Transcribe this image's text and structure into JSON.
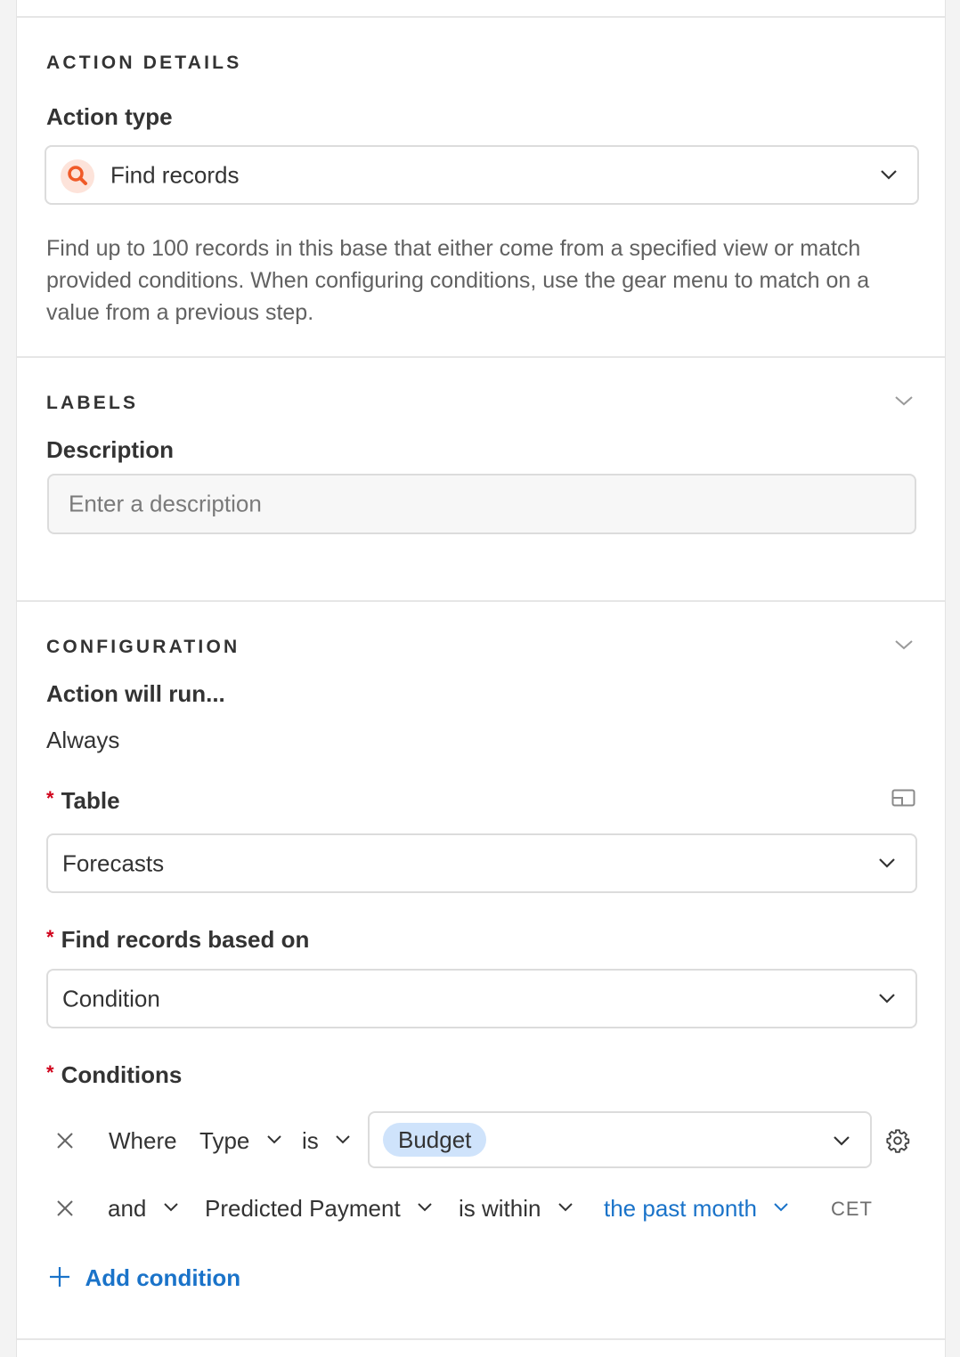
{
  "action_details": {
    "section_title": "ACTION DETAILS",
    "action_type_label": "Action type",
    "action_type_value": "Find records",
    "description": "Find up to 100 records in this base that either come from a specified view or match provided conditions. When configuring conditions, use the gear menu to match on a value from a previous step."
  },
  "labels": {
    "section_title": "LABELS",
    "description_label": "Description",
    "description_placeholder": "Enter a description"
  },
  "configuration": {
    "section_title": "CONFIGURATION",
    "run_label": "Action will run...",
    "run_value": "Always",
    "required_mark": "*",
    "table_label": "Table",
    "table_value": "Forecasts",
    "based_on_label": "Find records based on",
    "based_on_value": "Condition",
    "conditions_label": "Conditions",
    "conditions": [
      {
        "conjunction": "Where",
        "field": "Type",
        "operator": "is",
        "value": "Budget"
      },
      {
        "conjunction": "and",
        "field": "Predicted Payment",
        "operator": "is within",
        "value": "the past month",
        "timezone": "CET"
      }
    ],
    "add_condition_label": "Add condition"
  },
  "colors": {
    "accent_blue": "#1a73c9",
    "required_red": "#d0021b",
    "chip_blue": "#cfe3fb",
    "icon_orange": "#f05a28"
  }
}
